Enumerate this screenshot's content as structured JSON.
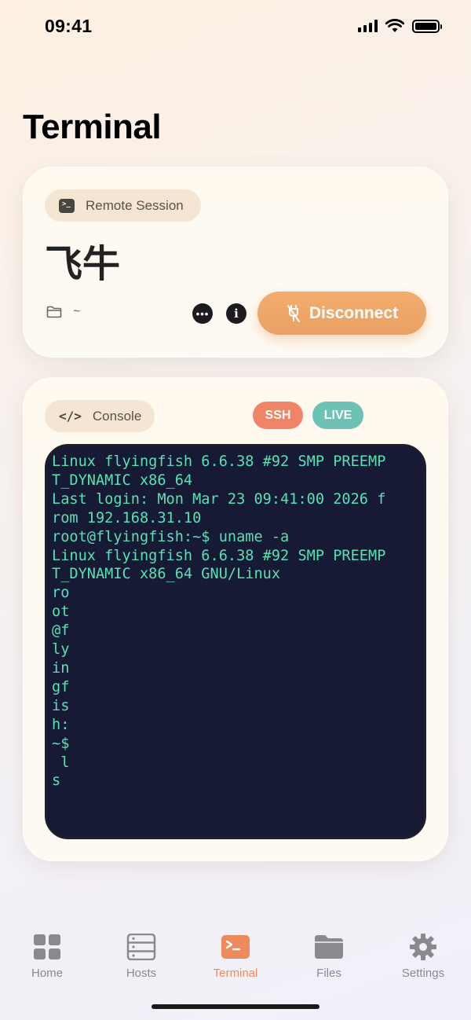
{
  "status_bar": {
    "time": "09:41"
  },
  "header": {
    "title": "Terminal"
  },
  "session": {
    "chip_label": "Remote Session",
    "host_name": "飞牛",
    "path": "~",
    "disconnect_label": "Disconnect"
  },
  "console": {
    "chip_label": "Console",
    "badges": {
      "protocol": "SSH",
      "state": "LIVE"
    },
    "lines": [
      "Linux flyingfish 6.6.38 #92 SMP PREEMP",
      "T_DYNAMIC x86_64",
      "Last login: Mon Mar 23 09:41:00 2026 f",
      "rom 192.168.31.10",
      "root@flyingfish:~$ uname -a",
      "Linux flyingfish 6.6.38 #92 SMP PREEMP",
      "T_DYNAMIC x86_64 GNU/Linux",
      "ro",
      "ot",
      "@f",
      "ly",
      "in",
      "gf",
      "is",
      "h:",
      "~$",
      " l",
      "s"
    ]
  },
  "tabs": [
    {
      "label": "Home",
      "icon": "grid-icon"
    },
    {
      "label": "Hosts",
      "icon": "server-icon"
    },
    {
      "label": "Terminal",
      "icon": "terminal-icon"
    },
    {
      "label": "Files",
      "icon": "folder-icon"
    },
    {
      "label": "Settings",
      "icon": "gear-icon"
    }
  ],
  "colors": {
    "accent": "#EF8A5E",
    "disconnect": "#EDA468",
    "ssh_badge": "#EF8466",
    "live_badge": "#6CC3B5",
    "terminal_bg": "#171A35",
    "terminal_text": "#59E0B3"
  }
}
